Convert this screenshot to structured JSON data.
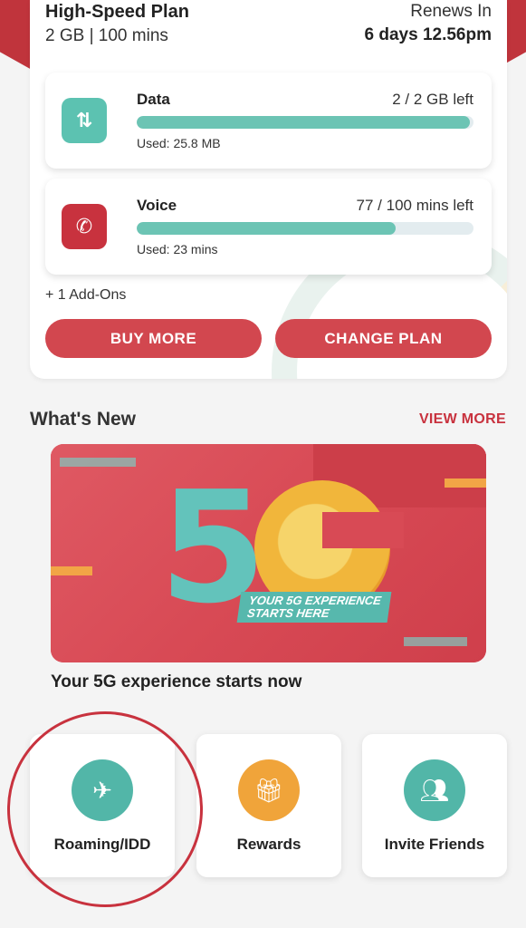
{
  "plan": {
    "name": "High-Speed Plan",
    "summary": "2 GB | 100 mins",
    "renews_label": "Renews In",
    "renews_value": "6 days 12.56pm"
  },
  "usage": {
    "data": {
      "title": "Data",
      "left": "2 / 2 GB left",
      "used": "Used: 25.8 MB",
      "fill_percent": 99,
      "icon": "arrows-up-down-icon"
    },
    "voice": {
      "title": "Voice",
      "left": "77 / 100 mins left",
      "used": "Used: 23 mins",
      "fill_percent": 77,
      "icon": "phone-icon"
    }
  },
  "addons": "+ 1 Add-Ons",
  "buttons": {
    "buy_more": "BUY MORE",
    "change_plan": "CHANGE PLAN"
  },
  "whats_new": {
    "title": "What's New",
    "view_more": "VIEW MORE",
    "banner_tagline_1": "YOUR 5G EXPERIENCE",
    "banner_tagline_2": "STARTS HERE",
    "banner_big_text": "5",
    "caption": "Your 5G experience starts now"
  },
  "tiles": [
    {
      "label": "Roaming/IDD",
      "icon": "plane-phone-icon"
    },
    {
      "label": "Rewards",
      "icon": "gift-icon"
    },
    {
      "label": "Invite Friends",
      "icon": "people-icon"
    }
  ],
  "colors": {
    "accent_red": "#d2474f",
    "teal": "#5cc2b1",
    "orange": "#f0a43a"
  }
}
